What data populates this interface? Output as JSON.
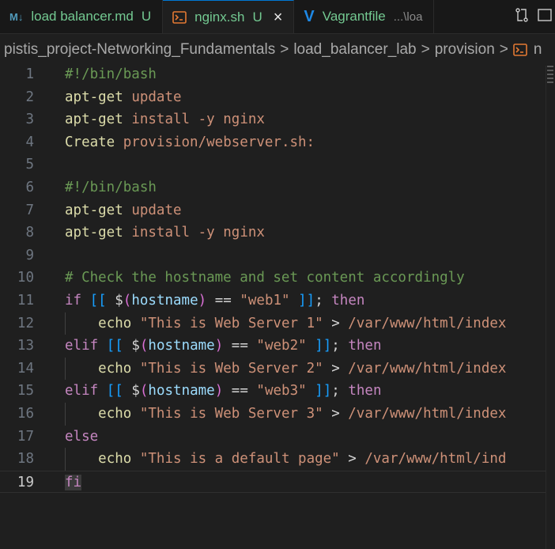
{
  "tabs": [
    {
      "id": "md",
      "icon": "markdown-icon",
      "icon_text": "M↓",
      "name": "load balancer.md",
      "state": "U",
      "active": false
    },
    {
      "id": "sh",
      "icon": "shell-icon",
      "icon_text": "",
      "name": "nginx.sh",
      "state": "U",
      "active": true,
      "close": "×"
    },
    {
      "id": "vg",
      "icon": "vagrant-icon",
      "icon_text": "V",
      "name": "Vagrantfile",
      "path": "...\\loa",
      "active": false
    }
  ],
  "breadcrumb": [
    "pistis_project-Networking_Fundamentals",
    "load_balancer_lab",
    "provision",
    "n"
  ],
  "breadcrumb_sep": ">",
  "current_line": 19,
  "lines": [
    {
      "n": "1",
      "tokens": [
        {
          "t": "#!/bin/bash",
          "c": "comment"
        }
      ]
    },
    {
      "n": "2",
      "tokens": [
        {
          "t": "apt-get",
          "c": "cmd"
        },
        {
          "t": " ",
          "c": "plain"
        },
        {
          "t": "update",
          "c": "arg"
        }
      ]
    },
    {
      "n": "3",
      "tokens": [
        {
          "t": "apt-get",
          "c": "cmd"
        },
        {
          "t": " ",
          "c": "plain"
        },
        {
          "t": "install",
          "c": "arg"
        },
        {
          "t": " ",
          "c": "plain"
        },
        {
          "t": "-y",
          "c": "arg"
        },
        {
          "t": " ",
          "c": "plain"
        },
        {
          "t": "nginx",
          "c": "arg"
        }
      ]
    },
    {
      "n": "4",
      "tokens": [
        {
          "t": "Create",
          "c": "cmd"
        },
        {
          "t": " ",
          "c": "plain"
        },
        {
          "t": "provision/webserver.sh:",
          "c": "arg"
        }
      ]
    },
    {
      "n": "5",
      "tokens": []
    },
    {
      "n": "6",
      "tokens": [
        {
          "t": "#!/bin/bash",
          "c": "comment"
        }
      ]
    },
    {
      "n": "7",
      "tokens": [
        {
          "t": "apt-get",
          "c": "cmd"
        },
        {
          "t": " ",
          "c": "plain"
        },
        {
          "t": "update",
          "c": "arg"
        }
      ]
    },
    {
      "n": "8",
      "tokens": [
        {
          "t": "apt-get",
          "c": "cmd"
        },
        {
          "t": " ",
          "c": "plain"
        },
        {
          "t": "install",
          "c": "arg"
        },
        {
          "t": " ",
          "c": "plain"
        },
        {
          "t": "-y",
          "c": "arg"
        },
        {
          "t": " ",
          "c": "plain"
        },
        {
          "t": "nginx",
          "c": "arg"
        }
      ]
    },
    {
      "n": "9",
      "tokens": []
    },
    {
      "n": "10",
      "tokens": [
        {
          "t": "# Check the hostname and set content accordingly",
          "c": "comment"
        }
      ]
    },
    {
      "n": "11",
      "tokens": [
        {
          "t": "if",
          "c": "kw"
        },
        {
          "t": " ",
          "c": "plain"
        },
        {
          "t": "[[",
          "c": "brk"
        },
        {
          "t": " ",
          "c": "plain"
        },
        {
          "t": "$",
          "c": "var"
        },
        {
          "t": "(",
          "c": "paren"
        },
        {
          "t": "hostname",
          "c": "fn"
        },
        {
          "t": ")",
          "c": "paren"
        },
        {
          "t": " == ",
          "c": "op"
        },
        {
          "t": "\"web1\"",
          "c": "str"
        },
        {
          "t": " ",
          "c": "plain"
        },
        {
          "t": "]]",
          "c": "brk"
        },
        {
          "t": "; ",
          "c": "plain"
        },
        {
          "t": "then",
          "c": "kw"
        }
      ]
    },
    {
      "n": "12",
      "indent": true,
      "tokens": [
        {
          "t": "    ",
          "c": "plain"
        },
        {
          "t": "echo",
          "c": "cmd"
        },
        {
          "t": " ",
          "c": "plain"
        },
        {
          "t": "\"This is Web Server 1\"",
          "c": "str"
        },
        {
          "t": " > ",
          "c": "op"
        },
        {
          "t": "/var/www/html/index",
          "c": "arg"
        }
      ]
    },
    {
      "n": "13",
      "tokens": [
        {
          "t": "elif",
          "c": "kw"
        },
        {
          "t": " ",
          "c": "plain"
        },
        {
          "t": "[[",
          "c": "brk"
        },
        {
          "t": " ",
          "c": "plain"
        },
        {
          "t": "$",
          "c": "var"
        },
        {
          "t": "(",
          "c": "paren"
        },
        {
          "t": "hostname",
          "c": "fn"
        },
        {
          "t": ")",
          "c": "paren"
        },
        {
          "t": " == ",
          "c": "op"
        },
        {
          "t": "\"web2\"",
          "c": "str"
        },
        {
          "t": " ",
          "c": "plain"
        },
        {
          "t": "]]",
          "c": "brk"
        },
        {
          "t": "; ",
          "c": "plain"
        },
        {
          "t": "then",
          "c": "kw"
        }
      ]
    },
    {
      "n": "14",
      "indent": true,
      "tokens": [
        {
          "t": "    ",
          "c": "plain"
        },
        {
          "t": "echo",
          "c": "cmd"
        },
        {
          "t": " ",
          "c": "plain"
        },
        {
          "t": "\"This is Web Server 2\"",
          "c": "str"
        },
        {
          "t": " > ",
          "c": "op"
        },
        {
          "t": "/var/www/html/index",
          "c": "arg"
        }
      ]
    },
    {
      "n": "15",
      "tokens": [
        {
          "t": "elif",
          "c": "kw"
        },
        {
          "t": " ",
          "c": "plain"
        },
        {
          "t": "[[",
          "c": "brk"
        },
        {
          "t": " ",
          "c": "plain"
        },
        {
          "t": "$",
          "c": "var"
        },
        {
          "t": "(",
          "c": "paren"
        },
        {
          "t": "hostname",
          "c": "fn"
        },
        {
          "t": ")",
          "c": "paren"
        },
        {
          "t": " == ",
          "c": "op"
        },
        {
          "t": "\"web3\"",
          "c": "str"
        },
        {
          "t": " ",
          "c": "plain"
        },
        {
          "t": "]]",
          "c": "brk"
        },
        {
          "t": "; ",
          "c": "plain"
        },
        {
          "t": "then",
          "c": "kw"
        }
      ]
    },
    {
      "n": "16",
      "indent": true,
      "tokens": [
        {
          "t": "    ",
          "c": "plain"
        },
        {
          "t": "echo",
          "c": "cmd"
        },
        {
          "t": " ",
          "c": "plain"
        },
        {
          "t": "\"This is Web Server 3\"",
          "c": "str"
        },
        {
          "t": " > ",
          "c": "op"
        },
        {
          "t": "/var/www/html/index",
          "c": "arg"
        }
      ]
    },
    {
      "n": "17",
      "tokens": [
        {
          "t": "else",
          "c": "kw"
        }
      ]
    },
    {
      "n": "18",
      "indent": true,
      "tokens": [
        {
          "t": "    ",
          "c": "plain"
        },
        {
          "t": "echo",
          "c": "cmd"
        },
        {
          "t": " ",
          "c": "plain"
        },
        {
          "t": "\"This is a default page\"",
          "c": "str"
        },
        {
          "t": " > ",
          "c": "op"
        },
        {
          "t": "/var/www/html/ind",
          "c": "arg"
        }
      ]
    },
    {
      "n": "19",
      "tokens": [
        {
          "t": "fi",
          "c": "kw",
          "hl": true
        }
      ]
    }
  ]
}
